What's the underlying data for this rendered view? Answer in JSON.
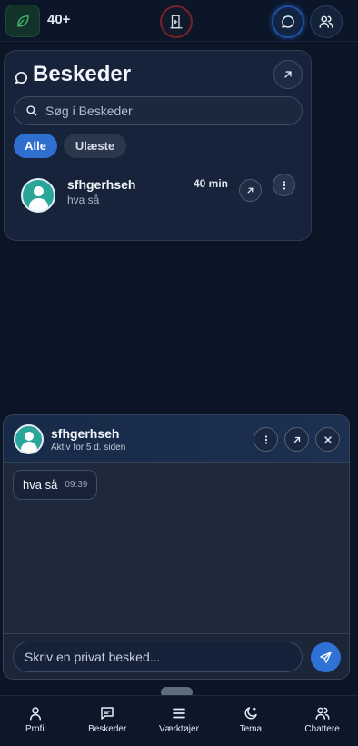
{
  "topbar": {
    "count": "40+"
  },
  "messages_panel": {
    "title": "Beskeder",
    "search_placeholder": "Søg i Beskeder",
    "filters": {
      "all": "Alle",
      "unread": "Ulæste"
    },
    "conversations": [
      {
        "name": "sfhgerhseh",
        "preview": "hva så",
        "time": "40 min"
      }
    ]
  },
  "chat_window": {
    "name": "sfhgerhseh",
    "status": "Aktiv for 5 d. siden",
    "messages": [
      {
        "text": "hva så",
        "time": "09:39"
      }
    ],
    "input_placeholder": "Skriv en privat besked..."
  },
  "bottom_nav": [
    {
      "label": "Profil",
      "icon": "person-icon"
    },
    {
      "label": "Beskeder",
      "icon": "message-icon"
    },
    {
      "label": "Værktøjer",
      "icon": "menu-icon"
    },
    {
      "label": "Tema",
      "icon": "moon-icon"
    },
    {
      "label": "Chattere",
      "icon": "users-icon"
    }
  ],
  "colors": {
    "accent": "#2f6fd0",
    "background": "#0b1526",
    "panel": "#17233a",
    "leaf": "#3fae6a",
    "logout": "#7a1f2b"
  }
}
